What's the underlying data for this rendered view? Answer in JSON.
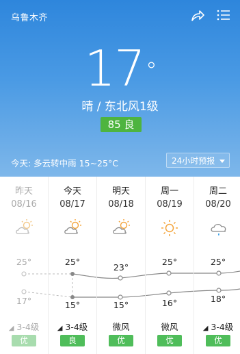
{
  "header": {
    "city": "乌鲁木齐",
    "share_icon": "share-icon",
    "menu_icon": "list-menu-icon"
  },
  "current": {
    "temp": "17",
    "deg": "°",
    "condition": "晴 / 东北风1级",
    "aqi": "85 良",
    "aqi_color": "#4eb43f",
    "today_summary": "今天:  多云转中雨   15~25°C",
    "forecast_button": "24小时预报"
  },
  "days": [
    {
      "day": "昨天",
      "date": "08/16",
      "icon": "partly-cloudy-icon",
      "hi": "25°",
      "lo": "17°",
      "wind": "3-4级",
      "quality": "优",
      "past": true
    },
    {
      "day": "今天",
      "date": "08/17",
      "icon": "partly-cloudy-icon",
      "hi": "25°",
      "lo": "15°",
      "wind": "3-4级",
      "quality": "良",
      "past": false
    },
    {
      "day": "明天",
      "date": "08/18",
      "icon": "partly-cloudy-icon",
      "hi": "23°",
      "lo": "15°",
      "wind": "微风",
      "quality": "优",
      "past": false
    },
    {
      "day": "周一",
      "date": "08/19",
      "icon": "sunny-icon",
      "hi": "25°",
      "lo": "16°",
      "wind": "微风",
      "quality": "优",
      "past": false
    },
    {
      "day": "周二",
      "date": "08/20",
      "icon": "rain-icon",
      "hi": "25°",
      "lo": "18°",
      "wind": "3-4级",
      "quality": "优",
      "past": false
    }
  ],
  "colors": {
    "quality_good": "#4fbd5a",
    "gradient_top": "#2e86dc",
    "gradient_bottom": "#7eb7ea"
  }
}
